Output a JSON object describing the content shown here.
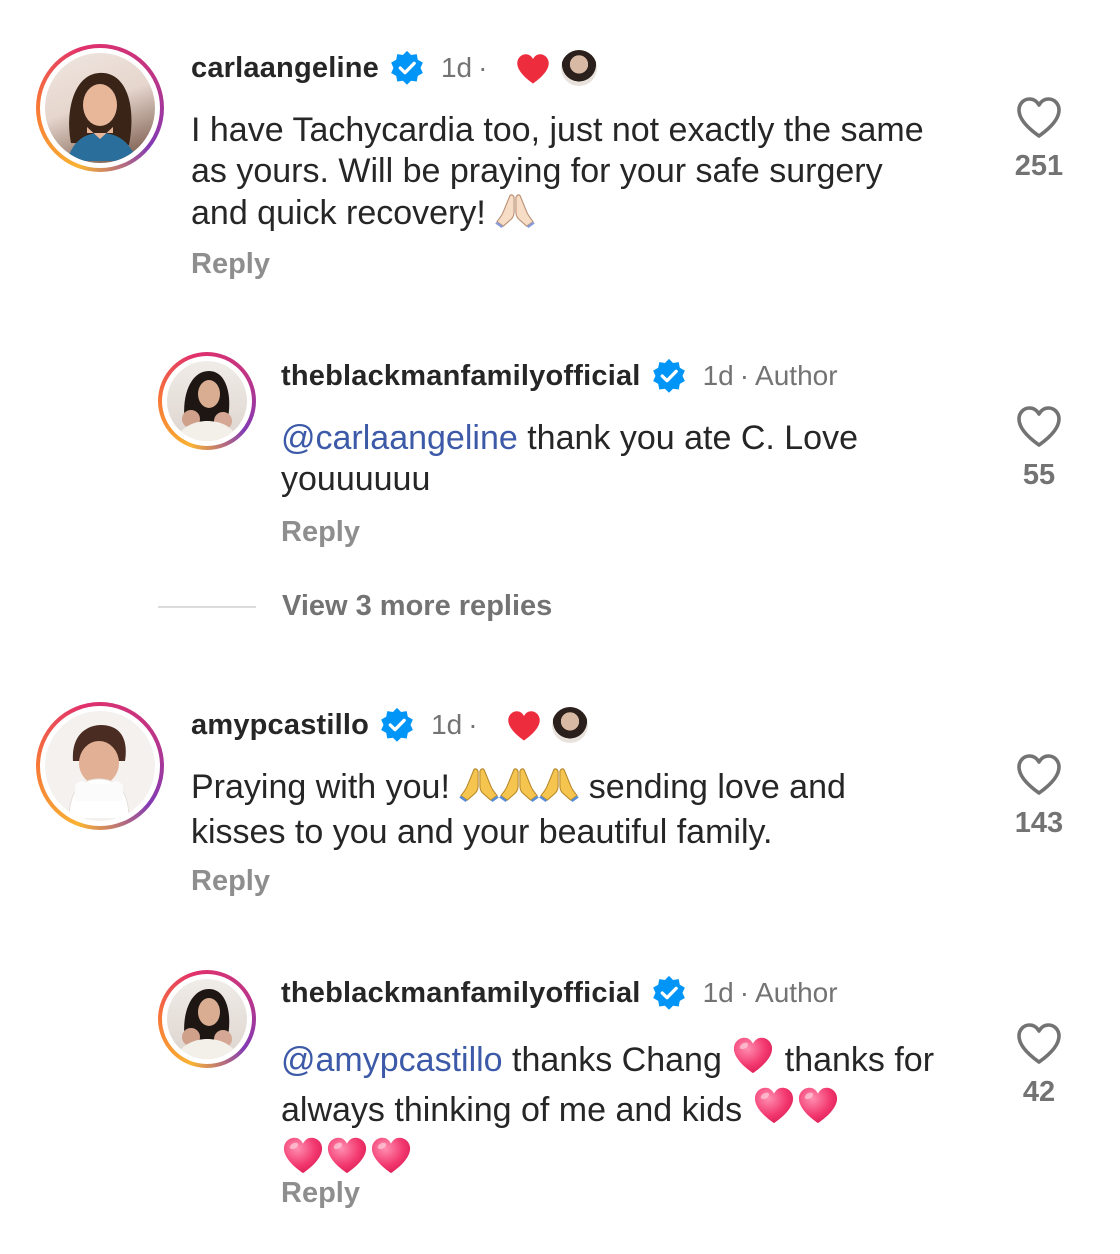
{
  "comments": [
    {
      "username": "carlaangeline",
      "time": "1d",
      "dot": "·",
      "text": "I have Tachycardia too, just not exactly the same as yours. Will be praying for your safe surgery and quick recovery!",
      "reply_label": "Reply",
      "likes": "251"
    },
    {
      "username": "theblackmanfamilyofficial",
      "time": "1d",
      "dot": "·",
      "author_badge": "Author",
      "mention": "@carlaangeline",
      "text": " thank you ate C. Love youuuuuu",
      "reply_label": "Reply",
      "likes": "55"
    },
    {
      "username": "amypcastillo",
      "time": "1d",
      "dot": "·",
      "text_a": "Praying with you! ",
      "text_b": " sending love and kisses to you and your beautiful family.",
      "reply_label": "Reply",
      "likes": "143"
    },
    {
      "username": "theblackmanfamilyofficial",
      "time": "1d",
      "dot": "·",
      "author_badge": "Author",
      "mention": "@amypcastillo",
      "text_a": " thanks Chang ",
      "text_b": " thanks for always thinking of me and kids ",
      "reply_label": "Reply",
      "likes": "42"
    }
  ],
  "view_more_replies": "View 3 more replies",
  "colors": {
    "verified": "#0095f6",
    "liked_heart": "#ed2d3d",
    "mention": "#3d5aa8",
    "muted": "#737373"
  },
  "icons": [
    "verified-badge-icon",
    "heart-outline-icon",
    "red-heart-icon",
    "folded-hands-emoji",
    "pink-heart-emoji"
  ]
}
